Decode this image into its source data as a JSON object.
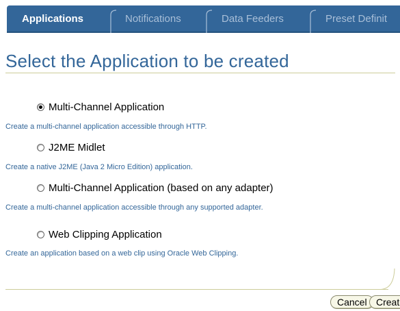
{
  "tabs": [
    {
      "label": "Applications",
      "active": true
    },
    {
      "label": "Notifications",
      "active": false
    },
    {
      "label": "Data Feeders",
      "active": false
    },
    {
      "label": "Preset Definit",
      "active": false
    }
  ],
  "page_title": "Select the Application to be created",
  "options": [
    {
      "label": "Multi-Channel Application",
      "selected": true,
      "description": "Create a multi-channel application accessible through HTTP."
    },
    {
      "label": "J2ME Midlet",
      "selected": false,
      "description": "Create a native J2ME (Java 2 Micro Edition) application."
    },
    {
      "label": "Multi-Channel Application (based on any adapter)",
      "selected": false,
      "description": "Create a multi-channel application accessible through any supported adapter."
    },
    {
      "label": "Web Clipping Application",
      "selected": false,
      "description": "Create an application based on a web clip using Oracle Web Clipping."
    }
  ],
  "buttons": {
    "cancel": "Cancel",
    "create": "Create"
  },
  "colors": {
    "tab_bar": "#336699",
    "title": "#336699",
    "description": "#336699",
    "rule": "#cccc99",
    "button_bg": "#f7f7e7"
  }
}
